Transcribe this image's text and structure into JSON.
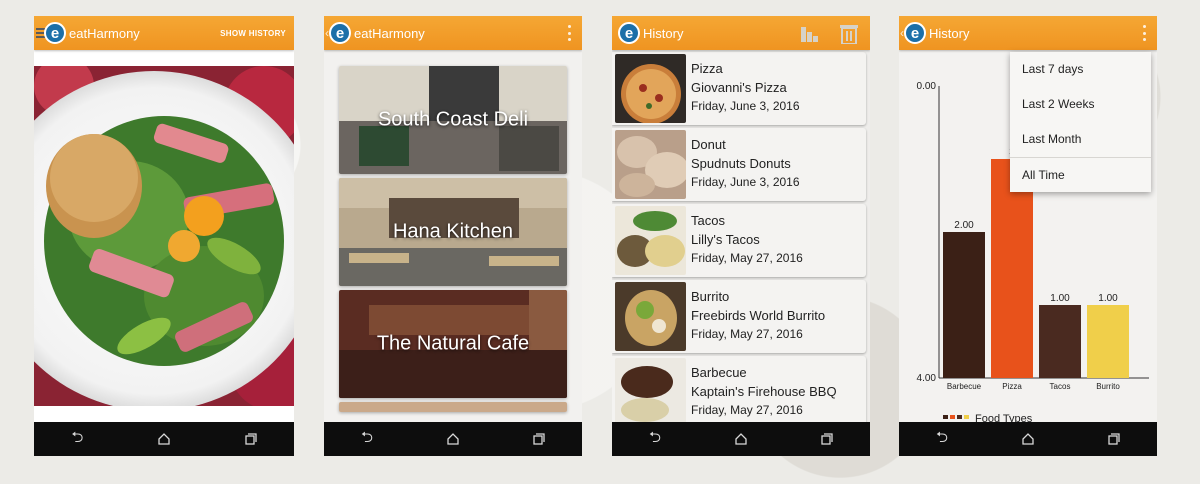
{
  "app": {
    "name": "eatHarmony",
    "logo_letter": "e"
  },
  "colors": {
    "appbar": "#f29a26",
    "logo": "#1c6fa8",
    "navbar": "#0d0d0d"
  },
  "screen1": {
    "title": "eatHarmony",
    "action": "SHOW HISTORY"
  },
  "screen2": {
    "title": "eatHarmony",
    "restaurants": [
      {
        "name": "South Coast Deli"
      },
      {
        "name": "Hana Kitchen"
      },
      {
        "name": "The Natural Cafe"
      }
    ]
  },
  "screen3": {
    "title": "History",
    "icons": [
      "bar-chart-icon",
      "trash-icon"
    ],
    "items": [
      {
        "food": "Pizza",
        "place": "Giovanni's Pizza",
        "date": "Friday, June 3, 2016"
      },
      {
        "food": "Donut",
        "place": "Spudnuts Donuts",
        "date": "Friday, June 3, 2016"
      },
      {
        "food": "Tacos",
        "place": "Lilly's Tacos",
        "date": "Friday, May 27, 2016"
      },
      {
        "food": "Burrito",
        "place": "Freebirds World Burrito",
        "date": "Friday, May 27, 2016"
      },
      {
        "food": "Barbecue",
        "place": "Kaptain's Firehouse BBQ",
        "date": "Friday, May 27, 2016"
      }
    ]
  },
  "screen4": {
    "title": "History",
    "menu": [
      "Last 7 days",
      "Last 2 Weeks",
      "Last Month",
      "All Time"
    ],
    "legend_label": "Food Types"
  },
  "chart_data": {
    "type": "bar",
    "categories": [
      "Barbecue",
      "Pizza",
      "Tacos",
      "Burrito"
    ],
    "values": [
      2.0,
      3.0,
      1.0,
      1.0
    ],
    "value_labels": [
      "2.00",
      "3",
      "1.00",
      "1.00"
    ],
    "colors": [
      "#3b2016",
      "#e8521b",
      "#4a2a20",
      "#f0cf4a"
    ],
    "ylim": [
      0,
      4
    ],
    "yticks": [
      "0.00",
      "4.00"
    ],
    "legend": "bottom"
  },
  "nav": {
    "back": "back-icon",
    "home": "home-icon",
    "recent": "recent-apps-icon"
  }
}
